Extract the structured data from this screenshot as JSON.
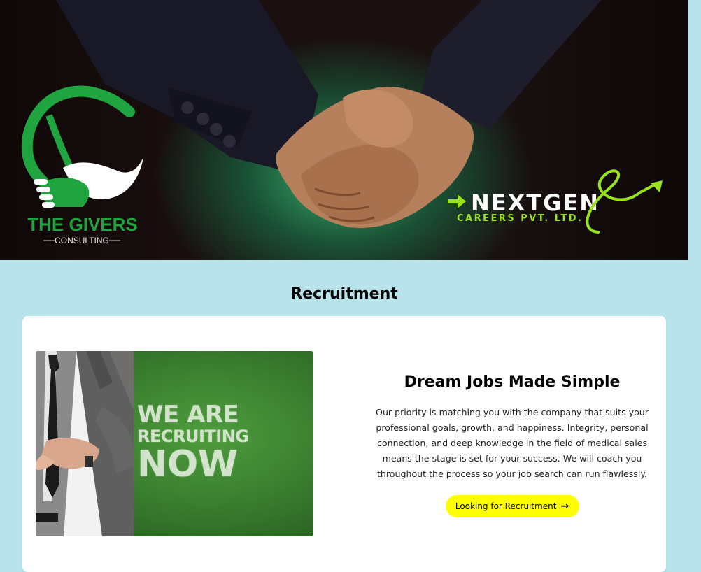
{
  "hero": {
    "left_logo": {
      "name": "THE GIVERS",
      "tagline": "CONSULTING",
      "color": "#1fa43f"
    },
    "right_logo": {
      "name": "NEXTGEN",
      "tagline": "CAREERS PVT. LTD.",
      "accent_color": "#9be21e"
    }
  },
  "section": {
    "title": "Recruitment"
  },
  "card": {
    "image": {
      "line1": "WE ARE",
      "line2": "RECRUITING",
      "line3": "NOW"
    },
    "heading": "Dream Jobs Made Simple",
    "text": "Our priority is matching you with the company that suits your professional goals, growth, and happiness. Integrity, personal connection, and deep knowledge in the field of medical sales means the stage is set for your success. We will coach you throughout the process so your job search can run flawlessly.",
    "button_label": "Looking for Recruitment",
    "button_icon": "arrow-right-icon",
    "button_color": "#ffff00"
  }
}
